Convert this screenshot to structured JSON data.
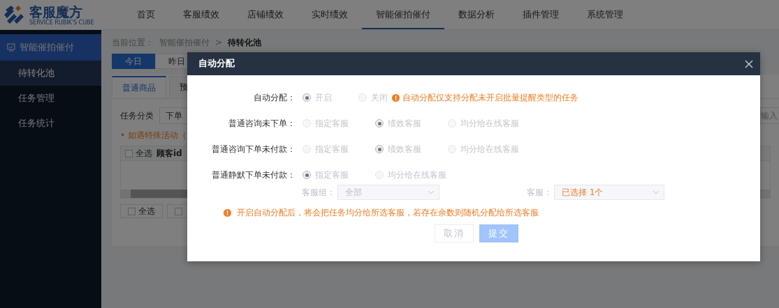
{
  "logo": {
    "name": "客服魔方",
    "tagline": "SERVICE RUBIK'S CUBE"
  },
  "nav": [
    {
      "label": "首页",
      "selected": false
    },
    {
      "label": "客服绩效",
      "selected": false
    },
    {
      "label": "店铺绩效",
      "selected": false
    },
    {
      "label": "实时绩效",
      "selected": false
    },
    {
      "label": "智能催拍催付",
      "selected": true
    },
    {
      "label": "数据分析",
      "selected": false
    },
    {
      "label": "插件管理",
      "selected": false
    },
    {
      "label": "系统管理",
      "selected": false
    }
  ],
  "sidebar": {
    "group": {
      "label": "智能催拍催付",
      "selected": true
    },
    "items": [
      {
        "label": "待转化池",
        "selected": true
      },
      {
        "label": "任务管理",
        "selected": false
      },
      {
        "label": "任务统计",
        "selected": false
      }
    ]
  },
  "breadcrumb": {
    "prefix": "当前位置：",
    "path": "智能催拍催付",
    "separator": ">",
    "current": "待转化池"
  },
  "date_tabs": [
    {
      "label": "今日",
      "selected": true
    },
    {
      "label": "昨日",
      "selected": false
    }
  ],
  "product_tabs": [
    {
      "label": "普通商品",
      "selected": true
    },
    {
      "label": "预",
      "selected": false
    }
  ],
  "filter": {
    "label": "任务分类",
    "value": "下单",
    "placeholder": "输入"
  },
  "notice": "• 如遇特殊活动（",
  "table": {
    "select_all": {
      "label": "全选",
      "checked": false
    },
    "columns": [
      "顾客id"
    ]
  },
  "footer_buttons": [
    {
      "label": "全选",
      "checked": false
    },
    {
      "checked": false
    }
  ],
  "dialog": {
    "title": "自动分配",
    "rows": [
      {
        "label": "自动分配：",
        "disabled": true,
        "options": [
          {
            "label": "开启",
            "selected": true
          },
          {
            "label": "关闭",
            "selected": false
          }
        ],
        "hint": "自动分配仅支持分配未开启批量提醒类型的任务"
      },
      {
        "label": "普通咨询未下单：",
        "disabled": true,
        "options": [
          {
            "label": "指定客服",
            "selected": false
          },
          {
            "label": "绩效客服",
            "selected": true
          },
          {
            "label": "均分给在线客服",
            "selected": false
          }
        ]
      },
      {
        "label": "普通咨询下单未付款：",
        "disabled": true,
        "options": [
          {
            "label": "指定客服",
            "selected": false
          },
          {
            "label": "绩效客服",
            "selected": true
          },
          {
            "label": "均分给在线客服",
            "selected": false
          }
        ]
      },
      {
        "label": "普通静默下单未付款：",
        "disabled": true,
        "options": [
          {
            "label": "指定客服",
            "selected": true
          },
          {
            "label": "均分给在线客服",
            "selected": false
          }
        ]
      }
    ],
    "selects": [
      {
        "label": "客服组：",
        "value": "全部",
        "highlight": false
      },
      {
        "label": "客服：",
        "value": "已选择 1个",
        "highlight": true
      }
    ],
    "warning": "开启自动分配后，将会把任务均分给所选客服，若存在余数则随机分配给所选客服",
    "buttons": [
      {
        "label": "取消",
        "kind": "secondary",
        "disabled": true
      },
      {
        "label": "提交",
        "kind": "primary",
        "disabled": true
      }
    ]
  }
}
